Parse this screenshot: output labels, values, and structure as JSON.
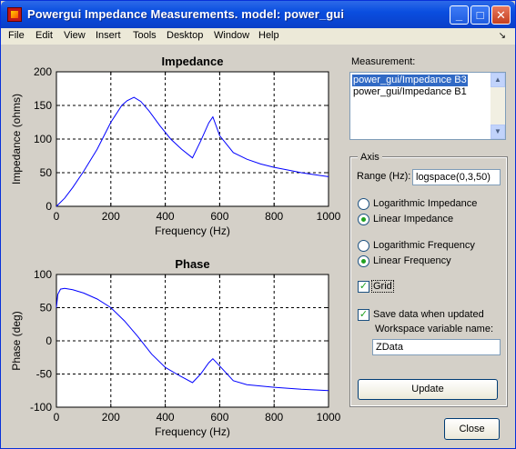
{
  "window": {
    "title": "Powergui Impedance Measurements. model: power_gui"
  },
  "menu": {
    "items": [
      "File",
      "Edit",
      "View",
      "Insert",
      "Tools",
      "Desktop",
      "Window",
      "Help"
    ],
    "dock_arrow": "↘"
  },
  "title_buttons": {
    "minimize": "_",
    "maximize": "□",
    "close": "✕"
  },
  "measurement": {
    "label": "Measurement:",
    "items": [
      {
        "label": "power_gui/Impedance B3",
        "selected": true
      },
      {
        "label": "power_gui/Impedance B1",
        "selected": false
      }
    ]
  },
  "axis": {
    "group_label": "Axis",
    "range_label": "Range (Hz):",
    "range_value": "logspace(0,3,50)",
    "impedance_options": [
      {
        "label": "Logarithmic Impedance",
        "selected": false
      },
      {
        "label": "Linear Impedance",
        "selected": true
      }
    ],
    "frequency_options": [
      {
        "label": "Logarithmic Frequency",
        "selected": false
      },
      {
        "label": "Linear Frequency",
        "selected": true
      }
    ],
    "grid_label": "Grid",
    "grid_checked": true,
    "save_label": "Save data when updated",
    "save_checked": true,
    "workspace_label": "Workspace variable name:",
    "workspace_value": "ZData",
    "update_label": "Update"
  },
  "close_label": "Close",
  "chart_data": [
    {
      "type": "line",
      "title": "Impedance",
      "xlabel": "Frequency (Hz)",
      "ylabel": "Impedance (ohms)",
      "xlim": [
        0,
        1000
      ],
      "ylim": [
        0,
        200
      ],
      "xticks": [
        0,
        200,
        400,
        600,
        800,
        1000
      ],
      "yticks": [
        0,
        50,
        100,
        150,
        200
      ],
      "grid": true,
      "color": "#0000ff",
      "series": [
        {
          "x": [
            0,
            30,
            60,
            100,
            150,
            200,
            240,
            260,
            285,
            310,
            340,
            380,
            420,
            460,
            500,
            530,
            560,
            575,
            600,
            650,
            700,
            750,
            800,
            850,
            900,
            950,
            1000
          ],
          "y": [
            0,
            12,
            28,
            52,
            85,
            125,
            150,
            157,
            162,
            156,
            142,
            120,
            100,
            85,
            72,
            97,
            124,
            133,
            105,
            80,
            70,
            63,
            58,
            54,
            50,
            47,
            44
          ]
        }
      ]
    },
    {
      "type": "line",
      "title": "Phase",
      "xlabel": "Frequency (Hz)",
      "ylabel": "Phase (deg)",
      "xlim": [
        0,
        1000
      ],
      "ylim": [
        -100,
        100
      ],
      "xticks": [
        0,
        200,
        400,
        600,
        800,
        1000
      ],
      "yticks": [
        -100,
        -50,
        0,
        50,
        100
      ],
      "grid": true,
      "color": "#0000ff",
      "series": [
        {
          "x": [
            0,
            5,
            15,
            30,
            60,
            100,
            150,
            200,
            250,
            300,
            350,
            400,
            450,
            500,
            530,
            560,
            575,
            600,
            650,
            700,
            800,
            900,
            1000
          ],
          "y": [
            50,
            70,
            78,
            79,
            77,
            72,
            63,
            50,
            30,
            6,
            -20,
            -40,
            -52,
            -63,
            -50,
            -33,
            -27,
            -38,
            -60,
            -66,
            -70,
            -73,
            -75
          ]
        }
      ]
    }
  ]
}
